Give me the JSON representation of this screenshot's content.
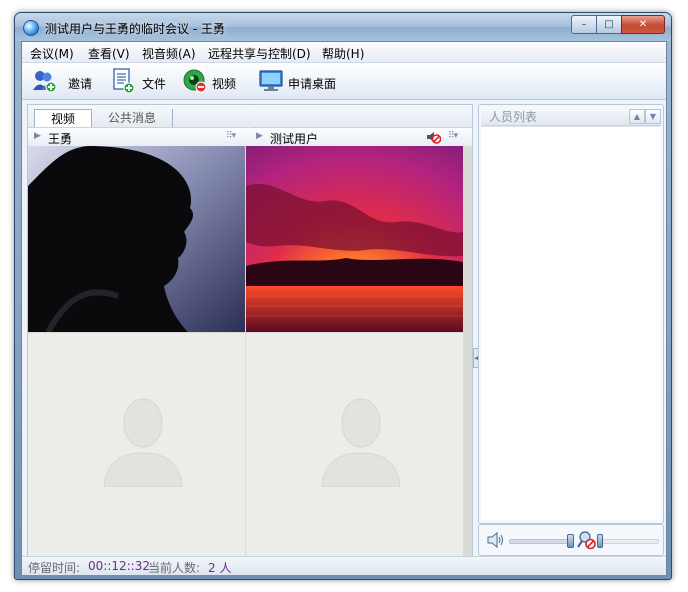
{
  "window": {
    "title": "测试用户与王勇的临时会议 - 王勇",
    "controls": {
      "minimize": "–",
      "maximize": "□",
      "close": "✕"
    }
  },
  "menubar": [
    "会议(M)",
    "查看(V)",
    "视音频(A)",
    "远程共享与控制(D)",
    "帮助(H)"
  ],
  "toolbar": [
    {
      "label": "邀请",
      "icon": "invite-users-icon"
    },
    {
      "label": "文件",
      "icon": "file-icon"
    },
    {
      "label": "视频",
      "icon": "video-icon"
    },
    {
      "label": "申请桌面",
      "icon": "desktop-icon"
    }
  ],
  "tabs": {
    "video": "视频",
    "messages": "公共消息"
  },
  "video_headers": [
    {
      "name": "王勇"
    },
    {
      "name": "测试用户"
    }
  ],
  "people_panel": {
    "title": "人员列表"
  },
  "statusbar": {
    "stay_label": "停留时间:",
    "stay_value": "00::12::32",
    "count_label": "当前人数:",
    "count_value": "2 人"
  },
  "colors": {
    "accent": "#3a6ea5",
    "status_value": "#6b2c86",
    "close_button": "#c44b34"
  }
}
